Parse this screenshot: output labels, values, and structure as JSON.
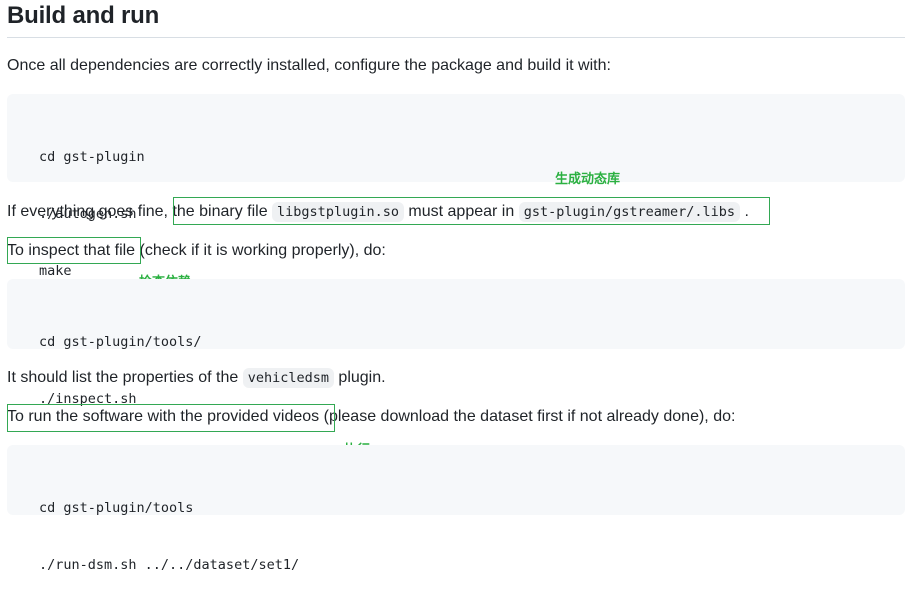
{
  "heading": "Build and run",
  "intro_text": "Once all dependencies are correctly installed, configure the package and build it with:",
  "build_code": {
    "lines": [
      "cd gst-plugin",
      "./autogen.sh",
      "make"
    ]
  },
  "binary_para": {
    "prefix": "If everything goes fine, ",
    "t1": "the binary file ",
    "code1": "libgstplugin.so",
    "t2": " must appear in ",
    "code2": "gst-plugin/gstreamer/.libs",
    "t3": " ."
  },
  "inspect_para": {
    "highlight": "To inspect that file",
    "rest": " (check if it is working properly), do:"
  },
  "inspect_code": {
    "lines": [
      "cd gst-plugin/tools/",
      "./inspect.sh"
    ]
  },
  "list_para": {
    "t1": "It should list the properties of the ",
    "code": "vehicledsm",
    "t2": " plugin."
  },
  "run_para": {
    "highlight": "To run the software with the provided videos",
    "rest": " (please download the dataset first if not already done), do:"
  },
  "run_code": {
    "lines": [
      "cd gst-plugin/tools",
      "./run-dsm.sh ../../dataset/set1/"
    ]
  },
  "annotations": {
    "lib_label": "生成动态库",
    "inspect_label": "检查依赖",
    "run_label": "执行",
    "color": "#2bb041"
  }
}
